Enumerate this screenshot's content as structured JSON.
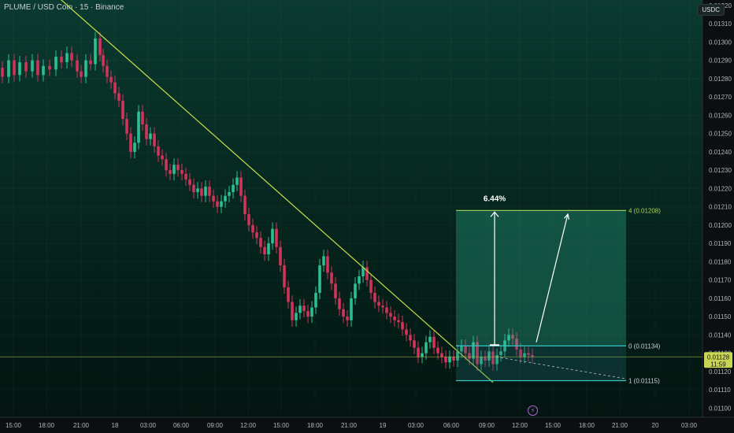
{
  "header": {
    "title": "PLUME / USD Coin · 15 · Binance",
    "currency": "USDC"
  },
  "colors": {
    "up": "#2bbf91",
    "down": "#d1345b",
    "trendline": "#c8e04a",
    "target_line": "#a8d85a",
    "stop_line": "#35c4c4",
    "entry_line": "#35c4c4",
    "current_price_bg": "#c8d455"
  },
  "chart_data": {
    "type": "candlestick",
    "symbol": "PLUME / USD Coin",
    "interval": "15",
    "exchange": "Binance",
    "ylim": [
      0.01095,
      0.01323
    ],
    "y_ticks": [
      "0.01320",
      "0.01310",
      "0.01300",
      "0.01290",
      "0.01280",
      "0.01270",
      "0.01260",
      "0.01250",
      "0.01240",
      "0.01230",
      "0.01220",
      "0.01210",
      "0.01200",
      "0.01190",
      "0.01180",
      "0.01170",
      "0.01160",
      "0.01150",
      "0.01140",
      "0.01130",
      "0.01120",
      "0.01110",
      "0.01100"
    ],
    "x_ticks": [
      "15:00",
      "18:00",
      "21:00",
      "18",
      "03:00",
      "06:00",
      "09:00",
      "12:00",
      "15:00",
      "18:00",
      "21:00",
      "19",
      "03:00",
      "06:00",
      "09:00",
      "12:00",
      "15:00",
      "18:00",
      "21:00",
      "20",
      "03:00"
    ],
    "price_path": [
      [
        0,
        0.01286
      ],
      [
        8,
        0.01281
      ],
      [
        15,
        0.0129
      ],
      [
        22,
        0.01282
      ],
      [
        30,
        0.01289
      ],
      [
        38,
        0.01284
      ],
      [
        45,
        0.0129
      ],
      [
        52,
        0.01282
      ],
      [
        60,
        0.01287
      ],
      [
        68,
        0.01285
      ],
      [
        75,
        0.01292
      ],
      [
        82,
        0.01289
      ],
      [
        88,
        0.01294
      ],
      [
        95,
        0.0129
      ],
      [
        100,
        0.01284
      ],
      [
        106,
        0.01281
      ],
      [
        112,
        0.0129
      ],
      [
        118,
        0.01288
      ],
      [
        124,
        0.01302
      ],
      [
        128,
        0.01293
      ],
      [
        133,
        0.01287
      ],
      [
        138,
        0.01281
      ],
      [
        143,
        0.01278
      ],
      [
        148,
        0.01272
      ],
      [
        153,
        0.01268
      ],
      [
        158,
        0.01258
      ],
      [
        163,
        0.0125
      ],
      [
        168,
        0.0124
      ],
      [
        173,
        0.01245
      ],
      [
        178,
        0.01262
      ],
      [
        183,
        0.01255
      ],
      [
        188,
        0.01247
      ],
      [
        193,
        0.0125
      ],
      [
        198,
        0.01243
      ],
      [
        203,
        0.01238
      ],
      [
        208,
        0.01236
      ],
      [
        213,
        0.0123
      ],
      [
        218,
        0.01228
      ],
      [
        223,
        0.01233
      ],
      [
        228,
        0.0123
      ],
      [
        233,
        0.01228
      ],
      [
        238,
        0.01225
      ],
      [
        243,
        0.01222
      ],
      [
        248,
        0.01218
      ],
      [
        253,
        0.0122
      ],
      [
        258,
        0.01216
      ],
      [
        263,
        0.01221
      ],
      [
        268,
        0.01216
      ],
      [
        273,
        0.01213
      ],
      [
        278,
        0.0121
      ],
      [
        283,
        0.01213
      ],
      [
        288,
        0.01216
      ],
      [
        293,
        0.01218
      ],
      [
        298,
        0.01222
      ],
      [
        303,
        0.01226
      ],
      [
        308,
        0.01216
      ],
      [
        313,
        0.01206
      ],
      [
        318,
        0.012
      ],
      [
        323,
        0.01196
      ],
      [
        328,
        0.01193
      ],
      [
        333,
        0.01188
      ],
      [
        338,
        0.01184
      ],
      [
        343,
        0.0119
      ],
      [
        348,
        0.01198
      ],
      [
        353,
        0.01188
      ],
      [
        358,
        0.01178
      ],
      [
        363,
        0.01166
      ],
      [
        368,
        0.01158
      ],
      [
        373,
        0.01148
      ],
      [
        378,
        0.01152
      ],
      [
        383,
        0.01156
      ],
      [
        388,
        0.01153
      ],
      [
        393,
        0.0115
      ],
      [
        398,
        0.01155
      ],
      [
        403,
        0.01163
      ],
      [
        408,
        0.01178
      ],
      [
        413,
        0.01183
      ],
      [
        418,
        0.01174
      ],
      [
        423,
        0.01168
      ],
      [
        428,
        0.0116
      ],
      [
        433,
        0.01154
      ],
      [
        438,
        0.0115
      ],
      [
        443,
        0.01148
      ],
      [
        448,
        0.0116
      ],
      [
        453,
        0.01168
      ],
      [
        458,
        0.01172
      ],
      [
        463,
        0.01177
      ],
      [
        468,
        0.0117
      ],
      [
        473,
        0.01163
      ],
      [
        478,
        0.01158
      ],
      [
        483,
        0.01156
      ],
      [
        488,
        0.01155
      ],
      [
        493,
        0.01152
      ],
      [
        498,
        0.0115
      ],
      [
        503,
        0.01148
      ],
      [
        508,
        0.01147
      ],
      [
        513,
        0.01143
      ],
      [
        518,
        0.0114
      ],
      [
        523,
        0.01137
      ],
      [
        528,
        0.01133
      ],
      [
        533,
        0.01128
      ],
      [
        538,
        0.0113
      ],
      [
        543,
        0.01136
      ],
      [
        548,
        0.01139
      ],
      [
        553,
        0.01133
      ],
      [
        558,
        0.0113
      ],
      [
        563,
        0.01128
      ],
      [
        568,
        0.01125
      ],
      [
        573,
        0.01128
      ],
      [
        578,
        0.01126
      ],
      [
        583,
        0.01131
      ],
      [
        588,
        0.01134
      ],
      [
        593,
        0.0113
      ],
      [
        598,
        0.01127
      ],
      [
        603,
        0.01136
      ],
      [
        608,
        0.01124
      ],
      [
        613,
        0.01128
      ],
      [
        618,
        0.01126
      ],
      [
        623,
        0.01131
      ],
      [
        628,
        0.01124
      ],
      [
        633,
        0.01129
      ],
      [
        638,
        0.01131
      ],
      [
        643,
        0.01137
      ],
      [
        648,
        0.0114
      ],
      [
        653,
        0.01138
      ],
      [
        658,
        0.01132
      ],
      [
        663,
        0.01128
      ],
      [
        668,
        0.0113
      ],
      [
        673,
        0.01129
      ],
      [
        678,
        0.01128
      ]
    ],
    "trendline": {
      "from": [
        70,
        0.01326
      ],
      "to": [
        626,
        0.01114
      ]
    },
    "projection_dashed": {
      "from": [
        630,
        0.01128
      ],
      "to": [
        795,
        0.01116
      ]
    },
    "position": {
      "target_label": "4 (0.01208)",
      "entry_label": "0 (0.01134)",
      "stop_label": "1 (0.01115)",
      "target": 0.01208,
      "entry": 0.01134,
      "stop": 0.01115,
      "percent_label": "6.44%"
    },
    "current_price": "0.01128",
    "countdown": "11:59"
  }
}
